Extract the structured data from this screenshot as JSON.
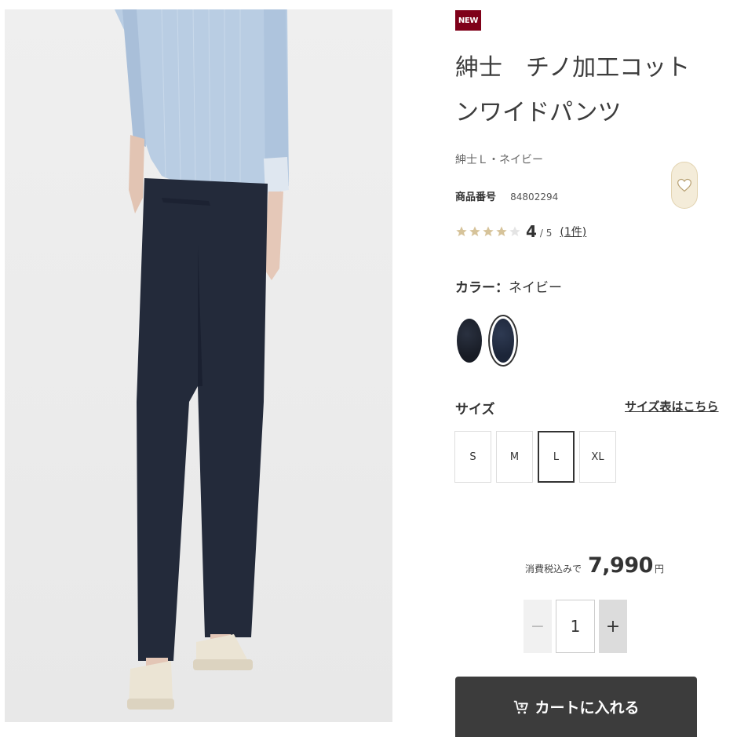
{
  "product": {
    "badge": "NEW",
    "title": "紳士　チノ加工コットンワイドパンツ",
    "variant": "紳士Ｌ・ネイビー",
    "sku_label": "商品番号",
    "sku": "84802294",
    "rating": {
      "stars_filled": 4,
      "stars_total": 5,
      "score": "4",
      "outof": "/ 5",
      "count": "(1件)"
    }
  },
  "color": {
    "label": "カラー",
    "sep": "：",
    "value": "ネイビー",
    "swatches": [
      {
        "name": "dark-navy",
        "hex": "#1b1f28",
        "selected": false
      },
      {
        "name": "navy",
        "hex": "#222c40",
        "selected": true
      }
    ]
  },
  "size": {
    "label": "サイズ",
    "chart_link": "サイズ表はこちら",
    "options": [
      "S",
      "M",
      "L",
      "XL"
    ],
    "selected": "L"
  },
  "price": {
    "tax_label": "消費税込みで",
    "amount": "7,990",
    "currency": "円"
  },
  "quantity": {
    "minus": "−",
    "value": "1",
    "plus": "+"
  },
  "cart": {
    "label": "カートに入れる",
    "icon": "cart-icon"
  },
  "icons": {
    "favorite": "heart-icon"
  },
  "colors": {
    "badge": "#7f0019",
    "cart_bg": "#3c3c3c",
    "fav_bg": "#f4ecd9"
  }
}
